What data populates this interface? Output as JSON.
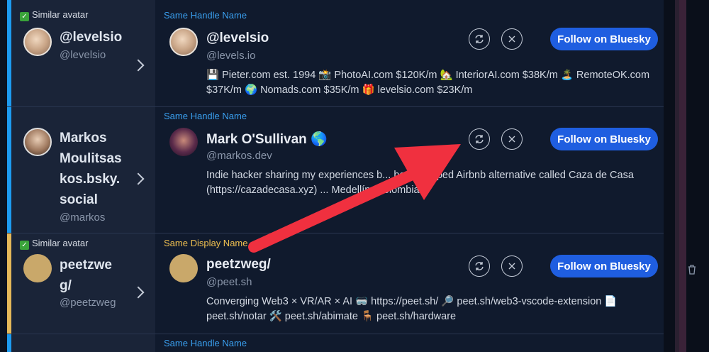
{
  "rows": [
    {
      "similar_avatar": "Similar avatar",
      "match_label": "Same Handle Name",
      "left_name": "@levelsio",
      "left_handle": "@levelsio",
      "display_name": "@levelsio",
      "handle": "@levels.io",
      "bio": "💾 Pieter.com est. 1994 📸 PhotoAI.com $120K/m 🏡 InteriorAI.com $38K/m 🏝️ RemoteOK.com $37K/m 🌍 Nomads.com $35K/m 🎁 levelsio.com $23K/m",
      "follow_label": "Follow on Bluesky",
      "accent_color": "#1d9bf0"
    },
    {
      "match_label": "Same Handle Name",
      "left_name_lines": [
        "Markos",
        "Moulitsas",
        "kos.bsky.",
        "social"
      ],
      "left_handle": "@markos",
      "display_name": "Mark O'Sullivan 🌎",
      "handle": "@markos.dev",
      "bio": "Indie hacker sharing my experiences b... bootstrapped Airbnb alternative called Caza de Casa (https://cazadecasa.xyz) ... Medellín, Colombia",
      "follow_label": "Follow on Bluesky",
      "accent_color": "#1d9bf0"
    },
    {
      "similar_avatar": "Similar avatar",
      "match_label": "Same Display Name",
      "left_name_lines": [
        "peetzwe",
        "g/"
      ],
      "left_handle": "@peetzweg",
      "display_name": "peetzweg/",
      "handle": "@peet.sh",
      "bio": "Converging Web3 × VR/AR × AI 🥽 https://peet.sh/ 🔎 peet.sh/web3-vscode-extension 📄 peet.sh/notar 🛠️ peet.sh/abimate 🪑 peet.sh/hardware",
      "follow_label": "Follow on Bluesky",
      "accent_color": "#e5b95a"
    },
    {
      "match_label": "Same Handle Name",
      "accent_color": "#1d9bf0"
    }
  ],
  "colors": {
    "follow_button": "#1f5ee0",
    "arrow": "#f0303f",
    "handle_tag": "#3aa0f0",
    "display_tag": "#f0c050"
  },
  "icons": [
    "refresh-icon",
    "close-icon",
    "chevron-right-icon",
    "check-icon",
    "trash-icon"
  ]
}
